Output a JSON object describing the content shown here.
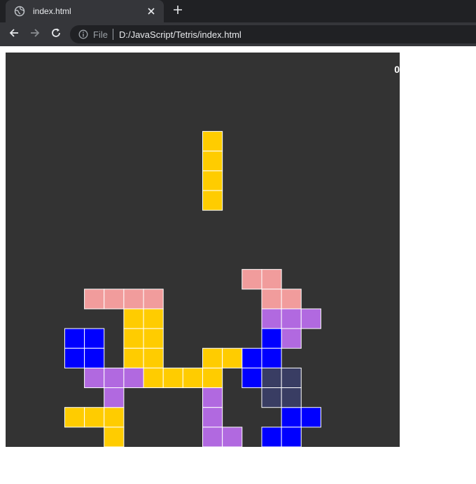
{
  "tab": {
    "title": "index.html"
  },
  "address_bar": {
    "security_label": "File",
    "url": "D:/JavaScript/Tetris/index.html"
  },
  "game": {
    "score": "0",
    "colors": {
      "yellow": "#ffcc00",
      "pink": "#f19c9c",
      "purple": "#b169e0",
      "blue": "#0000ff",
      "navy": "#393d63",
      "board": "#333333",
      "cell_border": "#ffffff"
    },
    "board_columns": 20,
    "board_rows": 20,
    "active_piece": {
      "color": "yellow",
      "cells": [
        [
          10,
          4
        ],
        [
          10,
          5
        ],
        [
          10,
          6
        ],
        [
          10,
          7
        ]
      ]
    },
    "settled_cells": [
      {
        "color": "pink",
        "cells": [
          [
            12,
            11
          ],
          [
            13,
            11
          ],
          [
            13,
            12
          ],
          [
            14,
            12
          ]
        ]
      },
      {
        "color": "pink",
        "cells": [
          [
            4,
            12
          ],
          [
            5,
            12
          ],
          [
            6,
            12
          ],
          [
            7,
            12
          ]
        ]
      },
      {
        "color": "yellow",
        "cells": [
          [
            6,
            13
          ],
          [
            7,
            13
          ],
          [
            6,
            14
          ],
          [
            7,
            14
          ],
          [
            6,
            15
          ],
          [
            7,
            15
          ]
        ]
      },
      {
        "color": "yellow",
        "cells": [
          [
            7,
            16
          ],
          [
            8,
            16
          ],
          [
            9,
            16
          ],
          [
            10,
            16
          ],
          [
            10,
            15
          ],
          [
            11,
            15
          ]
        ]
      },
      {
        "color": "yellow",
        "cells": [
          [
            3,
            18
          ],
          [
            4,
            18
          ],
          [
            5,
            18
          ],
          [
            5,
            19
          ]
        ]
      },
      {
        "color": "purple",
        "cells": [
          [
            13,
            13
          ],
          [
            14,
            13
          ],
          [
            15,
            13
          ],
          [
            14,
            14
          ]
        ]
      },
      {
        "color": "purple",
        "cells": [
          [
            4,
            16
          ],
          [
            5,
            16
          ],
          [
            6,
            16
          ],
          [
            5,
            17
          ]
        ]
      },
      {
        "color": "purple",
        "cells": [
          [
            10,
            17
          ],
          [
            10,
            18
          ],
          [
            10,
            19
          ],
          [
            11,
            19
          ]
        ]
      },
      {
        "color": "blue",
        "cells": [
          [
            3,
            14
          ],
          [
            4,
            14
          ],
          [
            3,
            15
          ],
          [
            4,
            15
          ]
        ]
      },
      {
        "color": "blue",
        "cells": [
          [
            13,
            14
          ],
          [
            12,
            15
          ],
          [
            13,
            15
          ],
          [
            12,
            16
          ]
        ]
      },
      {
        "color": "blue",
        "cells": [
          [
            14,
            18
          ],
          [
            15,
            18
          ],
          [
            13,
            19
          ],
          [
            14,
            19
          ]
        ]
      },
      {
        "color": "navy",
        "cells": [
          [
            13,
            16
          ],
          [
            14,
            16
          ],
          [
            13,
            17
          ],
          [
            14,
            17
          ]
        ]
      }
    ]
  }
}
